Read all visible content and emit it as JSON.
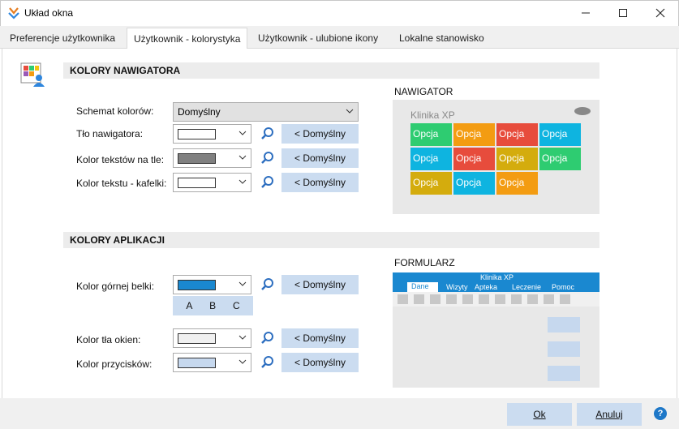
{
  "window": {
    "title": "Układ okna"
  },
  "tabs": [
    "Preferencje użytkownika",
    "Użytkownik - kolorystyka",
    "Użytkownik - ulubione ikony",
    "Lokalne stanowisko"
  ],
  "nav_section": {
    "title": "KOLORY NAWIGATORA",
    "scheme_label": "Schemat kolorów:",
    "scheme_value": "Domyślny",
    "rows": [
      {
        "label": "Tło nawigatora:",
        "color": "#ffffff",
        "default_label": "< Domyślny"
      },
      {
        "label": "Kolor tekstów na tle:",
        "color": "#808080",
        "default_label": "< Domyślny"
      },
      {
        "label": "Kolor tekstu - kafelki:",
        "color": "#ffffff",
        "default_label": "< Domyślny"
      }
    ]
  },
  "app_section": {
    "title": "KOLORY APLIKACJI",
    "rows": [
      {
        "label": "Kolor górnej belki:",
        "color": "#1a88d0",
        "default_label": "< Domyślny"
      },
      {
        "label": "Kolor tła okien:",
        "color": "#f0f0f0",
        "default_label": "< Domyślny"
      },
      {
        "label": "Kolor przycisków:",
        "color": "#c6d8ee",
        "default_label": "< Domyślny"
      }
    ],
    "abc": [
      "A",
      "B",
      "C"
    ]
  },
  "nav_preview": {
    "heading": "NAWIGATOR",
    "title": "Klinika XP",
    "tiles": [
      {
        "label": "Opcja",
        "color": "#2ecc71"
      },
      {
        "label": "Opcja",
        "color": "#f39c12"
      },
      {
        "label": "Opcja",
        "color": "#e74c3c"
      },
      {
        "label": "Opcja",
        "color": "#0eb4e0"
      },
      {
        "label": "Opcja",
        "color": "#0eb4e0"
      },
      {
        "label": "Opcja",
        "color": "#e74c3c"
      },
      {
        "label": "Opcja",
        "color": "#d4ac0d"
      },
      {
        "label": "Opcja",
        "color": "#2ecc71"
      },
      {
        "label": "Opcja",
        "color": "#d4ac0d"
      },
      {
        "label": "Opcja",
        "color": "#0eb4e0"
      },
      {
        "label": "Opcja",
        "color": "#f39c12"
      }
    ]
  },
  "form_preview": {
    "heading": "FORMULARZ",
    "title": "Klinika XP",
    "menu": [
      "Dane",
      "Wizyty",
      "Apteka",
      "Leczenie",
      "Pomoc"
    ]
  },
  "footer": {
    "ok": "Ok",
    "cancel": "Anuluj",
    "help": "?"
  },
  "colors": {
    "accent_bar": "#1a88d0",
    "button_bg": "#cbdcf0",
    "help_blue": "#1e78c8"
  }
}
